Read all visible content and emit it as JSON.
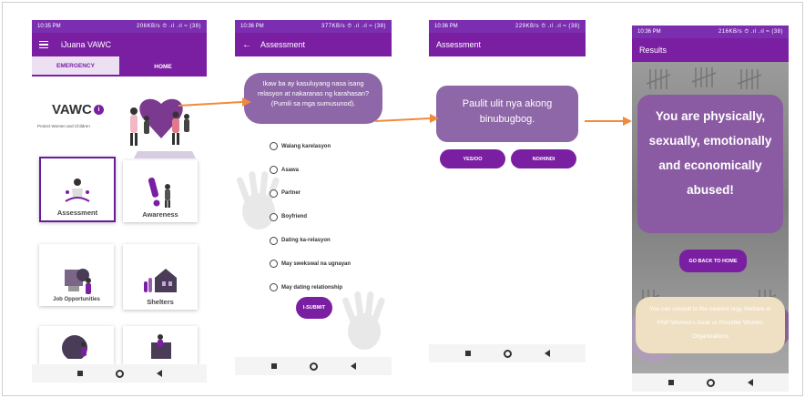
{
  "status": {
    "time_1": "10:35 PM",
    "time_2": "10:36 PM",
    "time_3": "10:36 PM",
    "time_4": "10:36 PM",
    "icons_1": "206KB/s ⏱ .ıl .ıl ≈ (38)",
    "icons_2": "377KB/s ⏱ .ıl .ıl ≈ (38)",
    "icons_3": "229KB/s ⏱ .ıl .ıl ≈ (38)",
    "icons_4": "216KB/s ⏱ .ıl .ıl ≈ (38)"
  },
  "screen1": {
    "app_title": "iJuana VAWC",
    "tabs": [
      {
        "label": "EMERGENCY"
      },
      {
        "label": "HOME"
      }
    ],
    "heading": "VAWC",
    "info_glyph": "i",
    "subtitle": "Protect Women and Children",
    "cards": [
      {
        "label": "Assessment"
      },
      {
        "label": "Awareness"
      },
      {
        "label": "Job Opportunities"
      },
      {
        "label": "Shelters"
      }
    ]
  },
  "screen2": {
    "title": "Assessment",
    "back_glyph": "←",
    "question": "Ikaw ba ay kasuluyang nasa isang relasyon at nakaranas ng karahasan? (Pumili sa mga sumusunod).",
    "options": [
      {
        "label": "Walang karelasyon"
      },
      {
        "label": "Asawa"
      },
      {
        "label": "Partner"
      },
      {
        "label": "Boyfriend"
      },
      {
        "label": "Dating ka-relasyon"
      },
      {
        "label": "May swekswal na ugnayan"
      },
      {
        "label": "May dating relationship"
      }
    ],
    "submit_label": "I-SUBMIT"
  },
  "screen3": {
    "title": "Assessment",
    "statement": "Paulit ulit nya akong binubugbog.",
    "yes_label": "YES/OO",
    "no_label": "NO/HINDI"
  },
  "screen4": {
    "title": "Results",
    "result": "You are physically, sexually, emotionally and economically abused!",
    "home_label": "GO BACK TO HOME",
    "consult": "You can consult to the nearest orgy Welfare or PNP Women's Desk or Possible Women Organizations"
  },
  "colors": {
    "primary": "#7b1fa2",
    "bubble": "#8e67a8",
    "arrow": "#f08a3c",
    "consult_bg": "#efe0c3"
  }
}
